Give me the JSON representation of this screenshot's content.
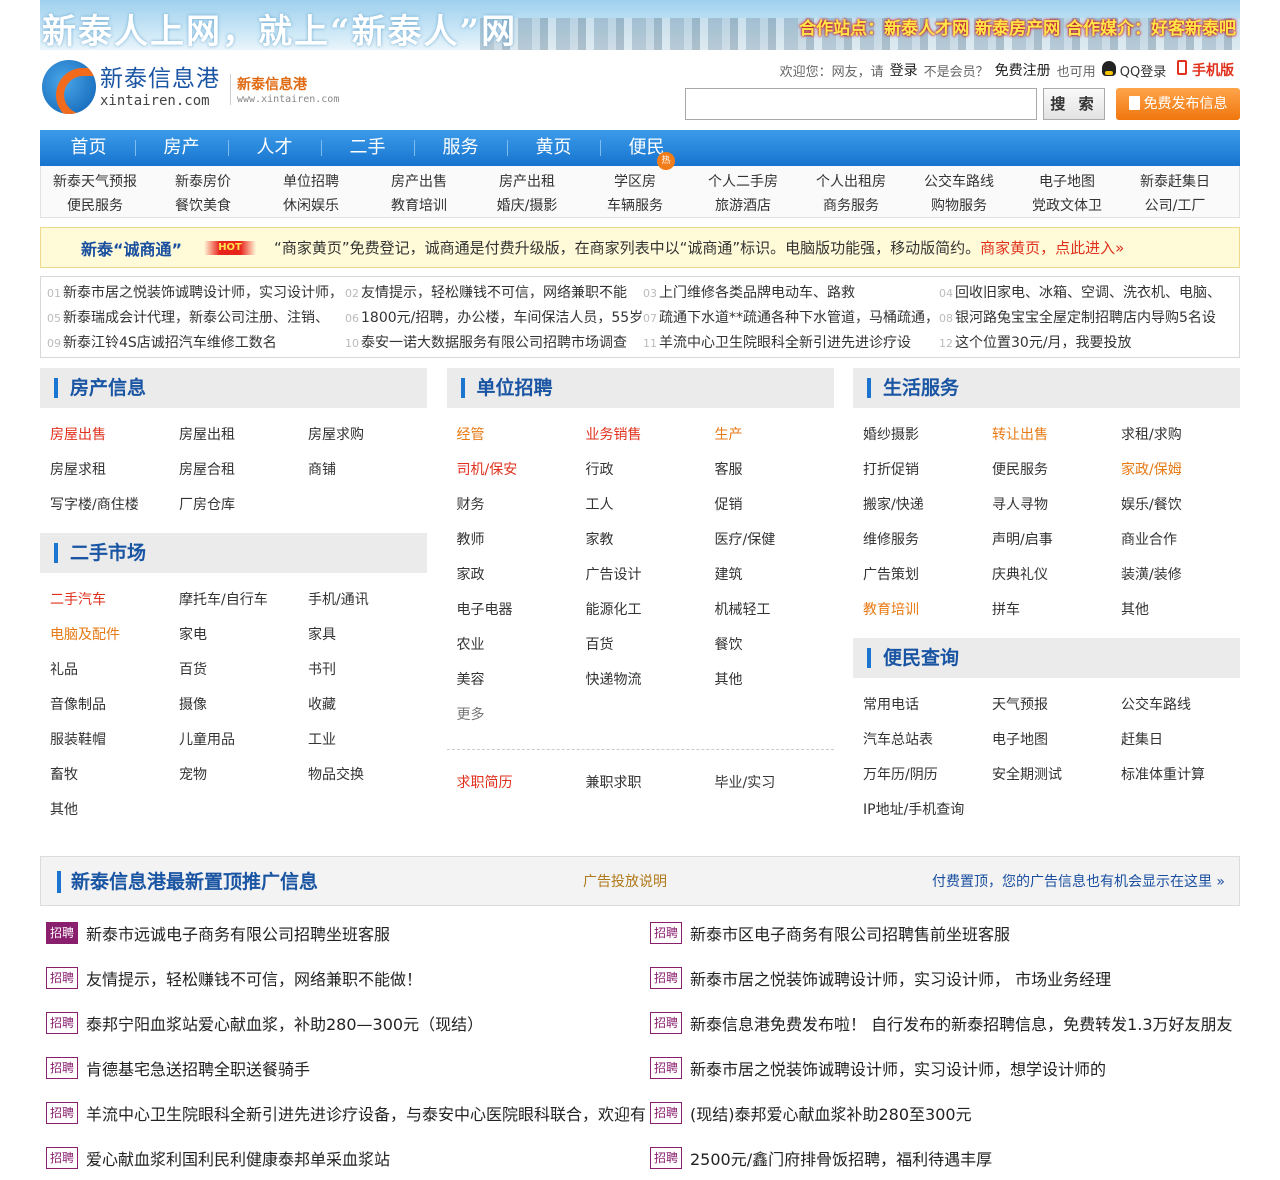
{
  "banner": {
    "slogan": "新泰人上网，就上“新泰人”网",
    "coop": "合作站点：新泰人才网  新泰房产网  合作媒介：好客新泰吧"
  },
  "logo": {
    "cn": "新泰信息港",
    "en": "xintairen.com"
  },
  "site_sub": {
    "cn": "新泰信息港",
    "en": "www.xintairen.com"
  },
  "userbar": {
    "welcome": "欢迎您：网友，请",
    "login": "登录",
    "not_member": "不是会员？",
    "register": "免费注册",
    "also": "也可用",
    "qq_login": "QQ登录",
    "mobile": "手机版"
  },
  "search": {
    "value": "",
    "button": "搜 索"
  },
  "post_button": "免费发布信息",
  "nav": {
    "items": [
      "首页",
      "房产",
      "人才",
      "二手",
      "服务",
      "黄页",
      "便民"
    ],
    "hot_badge": "热"
  },
  "subnav": {
    "row1": [
      "新泰天气预报",
      "新泰房价",
      "单位招聘",
      "房产出售",
      "房产出租",
      "学区房",
      "个人二手房",
      "个人出租房",
      "公交车路线",
      "电子地图",
      "新泰赶集日"
    ],
    "row2": [
      "便民服务",
      "餐饮美食",
      "休闲娱乐",
      "教育培训",
      "婚庆/摄影",
      "车辆服务",
      "旅游酒店",
      "商务服务",
      "购物服务",
      "党政文体卫",
      "公司/工厂"
    ]
  },
  "notice": {
    "title": "新泰“诚商通”",
    "hot": "HOT",
    "text": "“商家黄页”免费登记，诚商通是付费升级版，在商家列表中以“诚商通”标识。电脑版功能强，移动版简约。",
    "link": "商家黄页，点此进入»"
  },
  "ticker": [
    {
      "n": "01",
      "t": "新泰市居之悦装饰诚聘设计师，实习设计师，"
    },
    {
      "n": "02",
      "t": "友情提示，轻松赚钱不可信，网络兼职不能"
    },
    {
      "n": "03",
      "t": "上门维修各类品牌电动车、路救"
    },
    {
      "n": "04",
      "t": "回收旧家电、冰箱、空调、洗衣机、电脑、"
    },
    {
      "n": "05",
      "t": "新泰瑞成会计代理，新泰公司注册、注销、"
    },
    {
      "n": "06",
      "t": "1800元/招聘，办公楼，车间保洁人员，55岁以"
    },
    {
      "n": "07",
      "t": "疏通下水道**疏通各种下水管道，马桶疏通，"
    },
    {
      "n": "08",
      "t": "银河路兔宝宝全屋定制招聘店内导购5名设"
    },
    {
      "n": "09",
      "t": "新泰江铃4S店诚招汽车维修工数名"
    },
    {
      "n": "10",
      "t": "泰安一诺大数据服务有限公司招聘市场调查"
    },
    {
      "n": "11",
      "t": "羊流中心卫生院眼科全新引进先进诊疗设"
    },
    {
      "n": "12",
      "t": "这个位置30元/月，我要投放"
    }
  ],
  "house": {
    "title": "房产信息",
    "items": [
      {
        "t": "房屋出售",
        "c": "red"
      },
      {
        "t": "房屋出租",
        "c": ""
      },
      {
        "t": "房屋求购",
        "c": ""
      },
      {
        "t": "房屋求租",
        "c": ""
      },
      {
        "t": "房屋合租",
        "c": ""
      },
      {
        "t": "商铺",
        "c": ""
      },
      {
        "t": "写字楼/商住楼",
        "c": ""
      },
      {
        "t": "厂房仓库",
        "c": ""
      }
    ]
  },
  "second": {
    "title": "二手市场",
    "items": [
      {
        "t": "二手汽车",
        "c": "red"
      },
      {
        "t": "摩托车/自行车",
        "c": ""
      },
      {
        "t": "手机/通讯",
        "c": ""
      },
      {
        "t": "电脑及配件",
        "c": "orange"
      },
      {
        "t": "家电",
        "c": ""
      },
      {
        "t": "家具",
        "c": ""
      },
      {
        "t": "礼品",
        "c": ""
      },
      {
        "t": "百货",
        "c": ""
      },
      {
        "t": "书刊",
        "c": ""
      },
      {
        "t": "音像制品",
        "c": ""
      },
      {
        "t": "摄像",
        "c": ""
      },
      {
        "t": "收藏",
        "c": ""
      },
      {
        "t": "服装鞋帽",
        "c": ""
      },
      {
        "t": "儿童用品",
        "c": ""
      },
      {
        "t": "工业",
        "c": ""
      },
      {
        "t": "畜牧",
        "c": ""
      },
      {
        "t": "宠物",
        "c": ""
      },
      {
        "t": "物品交换",
        "c": ""
      },
      {
        "t": "其他",
        "c": ""
      }
    ]
  },
  "jobs": {
    "title": "单位招聘",
    "items": [
      {
        "t": "经管",
        "c": "orange"
      },
      {
        "t": "业务销售",
        "c": "red"
      },
      {
        "t": "生产",
        "c": "orange"
      },
      {
        "t": "司机/保安",
        "c": "red"
      },
      {
        "t": "行政",
        "c": ""
      },
      {
        "t": "客服",
        "c": ""
      },
      {
        "t": "财务",
        "c": ""
      },
      {
        "t": "工人",
        "c": ""
      },
      {
        "t": "促销",
        "c": ""
      },
      {
        "t": "教师",
        "c": ""
      },
      {
        "t": "家教",
        "c": ""
      },
      {
        "t": "医疗/保健",
        "c": ""
      },
      {
        "t": "家政",
        "c": ""
      },
      {
        "t": "广告设计",
        "c": ""
      },
      {
        "t": "建筑",
        "c": ""
      },
      {
        "t": "电子电器",
        "c": ""
      },
      {
        "t": "能源化工",
        "c": ""
      },
      {
        "t": "机械轻工",
        "c": ""
      },
      {
        "t": "农业",
        "c": ""
      },
      {
        "t": "百货",
        "c": ""
      },
      {
        "t": "餐饮",
        "c": ""
      },
      {
        "t": "美容",
        "c": ""
      },
      {
        "t": "快递物流",
        "c": ""
      },
      {
        "t": "其他",
        "c": ""
      },
      {
        "t": "更多",
        "c": "gray"
      }
    ],
    "seek": [
      {
        "t": "求职简历",
        "c": "red"
      },
      {
        "t": "兼职求职",
        "c": ""
      },
      {
        "t": "毕业/实习",
        "c": ""
      }
    ]
  },
  "life": {
    "title": "生活服务",
    "items": [
      {
        "t": "婚纱摄影",
        "c": ""
      },
      {
        "t": "转让出售",
        "c": "orange"
      },
      {
        "t": "求租/求购",
        "c": ""
      },
      {
        "t": "打折促销",
        "c": ""
      },
      {
        "t": "便民服务",
        "c": ""
      },
      {
        "t": "家政/保姆",
        "c": "orange"
      },
      {
        "t": "搬家/快递",
        "c": ""
      },
      {
        "t": "寻人寻物",
        "c": ""
      },
      {
        "t": "娱乐/餐饮",
        "c": ""
      },
      {
        "t": "维修服务",
        "c": ""
      },
      {
        "t": "声明/启事",
        "c": ""
      },
      {
        "t": "商业合作",
        "c": ""
      },
      {
        "t": "广告策划",
        "c": ""
      },
      {
        "t": "庆典礼仪",
        "c": ""
      },
      {
        "t": "装潢/装修",
        "c": ""
      },
      {
        "t": "教育培训",
        "c": "orange"
      },
      {
        "t": "拼车",
        "c": ""
      },
      {
        "t": "其他",
        "c": ""
      }
    ]
  },
  "query": {
    "title": "便民查询",
    "items": [
      {
        "t": "常用电话",
        "c": ""
      },
      {
        "t": "天气预报",
        "c": ""
      },
      {
        "t": "公交车路线",
        "c": ""
      },
      {
        "t": "汽车总站表",
        "c": ""
      },
      {
        "t": "电子地图",
        "c": ""
      },
      {
        "t": "赶集日",
        "c": ""
      },
      {
        "t": "万年历/阴历",
        "c": ""
      },
      {
        "t": "安全期测试",
        "c": ""
      },
      {
        "t": "标准体重计算",
        "c": ""
      },
      {
        "t": "IP地址/手机查询",
        "c": ""
      }
    ]
  },
  "promo": {
    "title": "新泰信息港最新置顶推广信息",
    "ad_link": "广告投放说明",
    "pay_text": "付费置顶，您的广告信息也有机会显示在这里 »",
    "tag": "招聘",
    "items": [
      "新泰市远诚电子商务有限公司招聘坐班客服",
      "新泰市区电子商务有限公司招聘售前坐班客服",
      "友情提示，轻松赚钱不可信，网络兼职不能做！",
      "新泰市居之悦装饰诚聘设计师，实习设计师， 市场业务经理",
      "泰邦宁阳血浆站爱心献血浆，补助280—300元（现结）",
      "新泰信息港免费发布啦！ 自行发布的新泰招聘信息，免费转发1.3万好友朋友",
      "肯德基宅急送招聘全职送餐骑手",
      "新泰市居之悦装饰诚聘设计师，实习设计师，想学设计师的",
      "羊流中心卫生院眼科全新引进先进诊疗设备，与泰安中心医院眼科联合，欢迎有",
      "(现结)泰邦爱心献血浆补助280至300元",
      "爱心献血浆利国利民利健康泰邦单采血浆站",
      "2500元/鑫门府排骨饭招聘，福利待遇丰厚"
    ]
  }
}
